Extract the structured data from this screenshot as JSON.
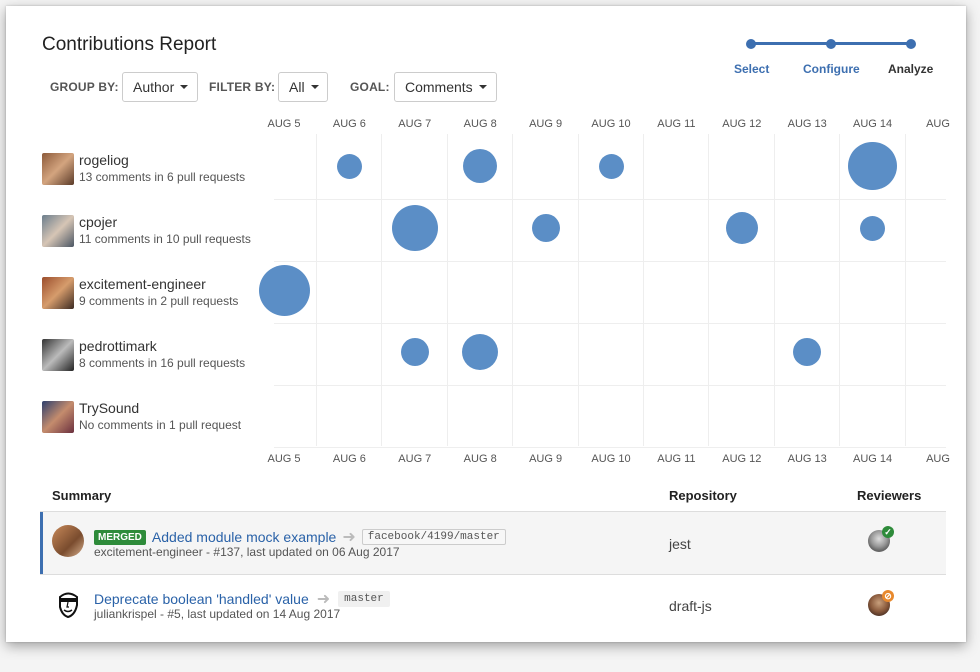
{
  "page": {
    "title": "Contributions Report"
  },
  "controls": {
    "group_by_label": "GROUP BY:",
    "group_by_value": "Author",
    "filter_by_label": "FILTER BY:",
    "filter_by_value": "All",
    "goal_label": "GOAL:",
    "goal_value": "Comments"
  },
  "wizard": {
    "steps": [
      "Select",
      "Configure",
      "Analyze"
    ],
    "current": "Analyze"
  },
  "chart_data": {
    "type": "scatter",
    "x_categories": [
      "AUG 5",
      "AUG 6",
      "AUG 7",
      "AUG 8",
      "AUG 9",
      "AUG 10",
      "AUG 11",
      "AUG 12",
      "AUG 13",
      "AUG 14",
      "AUG"
    ],
    "rows": [
      {
        "name": "rogeliog",
        "subtitle": "13 comments in 6 pull requests",
        "points": [
          {
            "x": "AUG 6",
            "size": 1
          },
          {
            "x": "AUG 8",
            "size": 3
          },
          {
            "x": "AUG 10",
            "size": 1
          },
          {
            "x": "AUG 14",
            "size": 8
          }
        ]
      },
      {
        "name": "cpojer",
        "subtitle": "11 comments in 10 pull requests",
        "points": [
          {
            "x": "AUG 7",
            "size": 7
          },
          {
            "x": "AUG 9",
            "size": 1.5
          },
          {
            "x": "AUG 12",
            "size": 2.5
          },
          {
            "x": "AUG 14",
            "size": 1
          }
        ]
      },
      {
        "name": "excitement-engineer",
        "subtitle": "9 comments in 2 pull requests",
        "points": [
          {
            "x": "AUG 5",
            "size": 9
          }
        ]
      },
      {
        "name": "pedrottimark",
        "subtitle": "8 comments in 16 pull requests",
        "points": [
          {
            "x": "AUG 7",
            "size": 1.5
          },
          {
            "x": "AUG 8",
            "size": 3.5
          },
          {
            "x": "AUG 13",
            "size": 1.5
          }
        ]
      },
      {
        "name": "TrySound",
        "subtitle": "No comments in 1 pull request",
        "points": []
      }
    ],
    "bubble_color": "#5b8ec6"
  },
  "summary": {
    "headers": {
      "summary": "Summary",
      "repository": "Repository",
      "reviewers": "Reviewers"
    },
    "rows": [
      {
        "badge": "MERGED",
        "title": "Added module mock example",
        "branch": "facebook/4199/master",
        "meta": "excitement-engineer - #137, last updated on 06 Aug 2017",
        "repo": "jest",
        "review_status": "approved"
      },
      {
        "badge": "",
        "title": "Deprecate boolean 'handled' value",
        "branch": "master",
        "meta": "juliankrispel - #5, last updated on 14 Aug 2017",
        "repo": "draft-js",
        "review_status": "pending"
      }
    ]
  },
  "colors": {
    "accent": "#3d6fb0",
    "merged": "#2e8b3a",
    "approved": "#2e8b3a",
    "pending": "#e8892d"
  }
}
